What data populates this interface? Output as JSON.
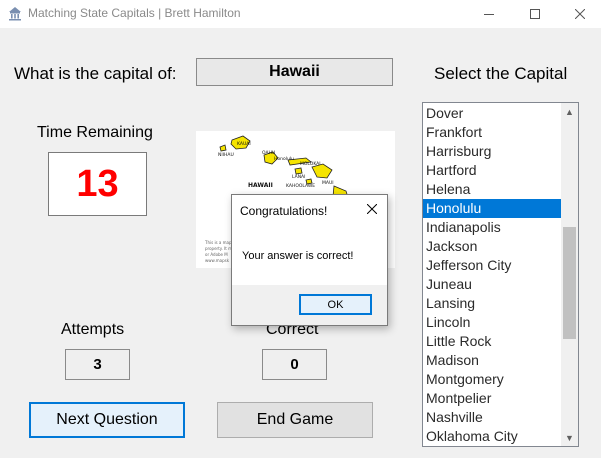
{
  "window": {
    "title": "Matching State Capitals  | Brett Hamilton"
  },
  "question": {
    "prompt": "What is the capital of:",
    "state": "Hawaii"
  },
  "select_label": "Select the Capital",
  "timer": {
    "label": "Time Remaining",
    "value": "13"
  },
  "map": {
    "labels": {
      "kauai": "KAUAI",
      "niihau": "NIIHAU",
      "oahu": "OAHU",
      "honolulu": "Honolulu",
      "molokai": "MOLOKAI",
      "lanai": "LANAI",
      "maui": "MAUI",
      "hawaii": "HAWAII",
      "kahoolawe": "KAHOOLAWE"
    },
    "footer_lines": [
      "This is a map",
      "property. It m",
      "or Adobe M",
      "www.mapsk"
    ]
  },
  "capitals": {
    "items": [
      "Dover",
      "Frankfort",
      "Harrisburg",
      "Hartford",
      "Helena",
      "Honolulu",
      "Indianapolis",
      "Jackson",
      "Jefferson City",
      "Juneau",
      "Lansing",
      "Lincoln",
      "Little Rock",
      "Madison",
      "Montgomery",
      "Montpelier",
      "Nashville",
      "Oklahoma City"
    ],
    "selected": "Honolulu"
  },
  "stats": {
    "attempts_label": "Attempts",
    "attempts_value": "3",
    "correct_label": "Correct",
    "correct_value": "0"
  },
  "buttons": {
    "next": "Next Question",
    "end": "End Game"
  },
  "dialog": {
    "title": "Congratulations!",
    "message": "Your answer is correct!",
    "ok": "OK"
  },
  "colors": {
    "timer": "#ff0000",
    "selection": "#0078d7",
    "island": "#f5e400"
  }
}
